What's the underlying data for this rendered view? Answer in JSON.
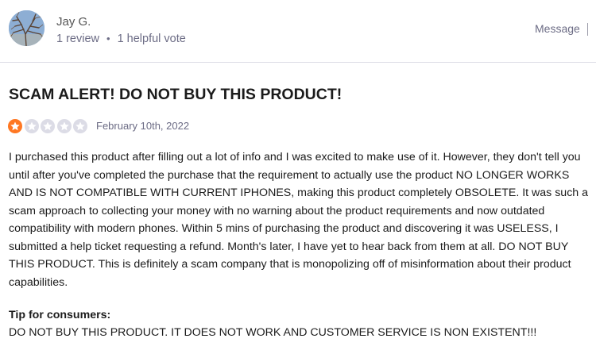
{
  "reviewer": {
    "name": "Jay G.",
    "reviews": "1 review",
    "separator": "•",
    "helpful_votes": "1 helpful vote",
    "message_label": "Message"
  },
  "review": {
    "title": "SCAM ALERT! DO NOT BUY THIS PRODUCT!",
    "rating": 1,
    "rating_max": 5,
    "date": "February 10th, 2022",
    "body": "I purchased this product after filling out a lot of info and I was excited to make use of it. However, they don't tell you until after you've completed the purchase that the requirement to actually use the product NO LONGER WORKS AND IS NOT COMPATIBLE WITH CURRENT IPHONES, making this product completely OBSOLETE. It was such a scam approach to collecting your money with no warning about the product requirements and now outdated compatibility with modern phones. Within 5 mins of purchasing the product and discovering it was USELESS, I submitted a help ticket requesting a refund. Month's later, I have yet to hear back from them at all. DO NOT BUY THIS PRODUCT. This is definitely a scam company that is monopolizing off of misinformation about their product capabilities.",
    "tip_label": "Tip for consumers:",
    "tip_text": "DO NOT BUY THIS PRODUCT. IT DOES NOT WORK AND CUSTOMER SERVICE IS NON EXISTENT!!!"
  },
  "colors": {
    "star_filled": "#ff7722",
    "star_empty": "#dcdce6",
    "muted_text": "#6c6c85",
    "border": "#dcdce6"
  },
  "icons": {
    "star": "star-icon",
    "avatar": "avatar-photo"
  }
}
